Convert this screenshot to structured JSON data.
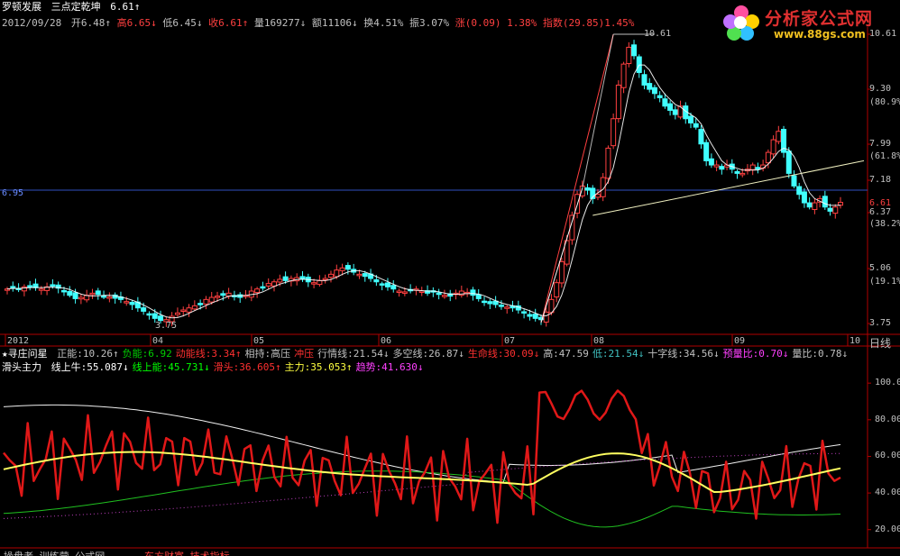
{
  "header": {
    "stock_name": "罗顿发展",
    "indicator_name": "三点定乾坤",
    "indicator_value": "6.61↑",
    "date": "2012/09/28",
    "open_label": "开",
    "open": "6.48↑",
    "high_label": "高",
    "high": "6.65↓",
    "low_label": "低",
    "low": "6.45↓",
    "close_label": "收",
    "close": "6.61↑",
    "vol_label": "量",
    "vol": "169277↓",
    "amt_label": "额",
    "amt": "11106↓",
    "turn_label": "换",
    "turn": "4.51%",
    "amp_label": "振",
    "amp": "3.07%",
    "chg_label": "涨",
    "chg": "(0.09)",
    "chg_pct": "1.38%",
    "idx_label": "指数",
    "idx": "(29.85)",
    "idx_pct": "1.45%"
  },
  "logo": {
    "title": "分析家公式网",
    "url": "www.88gs.com"
  },
  "price_axis": {
    "labels": [
      {
        "value": "10.61",
        "color": "#c0c0c0"
      },
      {
        "value": "9.30",
        "color": "#c0c0c0"
      },
      {
        "value": "(80.9%)",
        "color": "#c0c0c0"
      },
      {
        "value": "7.99",
        "color": "#c0c0c0"
      },
      {
        "value": "(61.8%)",
        "color": "#c0c0c0"
      },
      {
        "value": "7.18",
        "color": "#c0c0c0"
      },
      {
        "value": "6.61",
        "color": "#ff4040"
      },
      {
        "value": "6.37",
        "color": "#c0c0c0"
      },
      {
        "value": "(38.2%)",
        "color": "#c0c0c0"
      },
      {
        "value": "5.06",
        "color": "#c0c0c0"
      },
      {
        "value": "(19.1%)",
        "color": "#c0c0c0"
      },
      {
        "value": "3.75",
        "color": "#c0c0c0"
      }
    ],
    "ref_line_label": "6.95",
    "peak_label": "10.61",
    "trough_label": "3.75"
  },
  "time_axis": {
    "labels": [
      "2012",
      "04",
      "05",
      "06",
      "07",
      "08",
      "09",
      "10"
    ],
    "tab": "日线"
  },
  "indicator1": {
    "prefix": "★寻庄问星",
    "items": [
      {
        "label": "正能:",
        "value": "10.26↑",
        "color": "#c0c0c0"
      },
      {
        "label": "负能:",
        "value": "6.92",
        "color": "#00d000"
      },
      {
        "label": "动能线:",
        "value": "3.34↑",
        "color": "#ff3030"
      },
      {
        "label": "相持:",
        "value": "高压",
        "color": "#c0c0c0"
      },
      {
        "label": "",
        "value": "冲压",
        "color": "#ff3030"
      },
      {
        "label": "行情线:",
        "value": "21.54↓",
        "color": "#c0c0c0"
      },
      {
        "label": "多空线:",
        "value": "26.87↓",
        "color": "#c0c0c0"
      },
      {
        "label": "生命线:",
        "value": "30.09↓",
        "color": "#ff3030"
      },
      {
        "label": "高:",
        "value": "47.59",
        "color": "#c0c0c0"
      },
      {
        "label": "低:",
        "value": "21.54↓",
        "color": "#40c0c0"
      },
      {
        "label": "十字线:",
        "value": "34.56↓",
        "color": "#c0c0c0"
      },
      {
        "label": "预量比:",
        "value": "0.70↓",
        "color": "#ff40ff"
      },
      {
        "label": "量比:",
        "value": "0.78↓",
        "color": "#c0c0c0"
      }
    ]
  },
  "indicator2": {
    "prefix": "滑头主力",
    "items": [
      {
        "label": "线上牛:",
        "value": "55.087↓",
        "color": "#ffffff"
      },
      {
        "label": "线上能:",
        "value": "45.731↓",
        "color": "#00ff00"
      },
      {
        "label": "滑头:",
        "value": "36.605↑",
        "color": "#ff3030"
      },
      {
        "label": "主力:",
        "value": "35.053↑",
        "color": "#ffff40"
      },
      {
        "label": "趋势:",
        "value": "41.630↓",
        "color": "#ff40ff"
      }
    ],
    "axis": [
      "100.00",
      "80.00",
      "60.00",
      "40.00",
      "20.00"
    ]
  },
  "footer": {
    "left_text": "操盘者 训练营 公式网",
    "right_text": "东方财富 技术指标"
  },
  "chart_data": [
    {
      "type": "candlestick",
      "ylim": [
        3.75,
        10.61
      ],
      "peak": 10.61,
      "trough": 3.75,
      "reference_line": 6.95,
      "close_series": [
        4.55,
        4.58,
        4.56,
        4.6,
        4.62,
        4.58,
        4.55,
        4.6,
        4.62,
        4.57,
        4.5,
        4.4,
        4.32,
        4.35,
        4.4,
        4.45,
        4.42,
        4.38,
        4.36,
        4.33,
        4.3,
        4.25,
        4.18,
        4.1,
        4.02,
        3.95,
        3.85,
        3.8,
        3.82,
        3.9,
        3.98,
        4.05,
        4.1,
        4.15,
        4.18,
        4.3,
        4.35,
        4.38,
        4.4,
        4.45,
        4.38,
        4.35,
        4.4,
        4.5,
        4.55,
        4.6,
        4.68,
        4.72,
        4.78,
        4.75,
        4.8,
        4.82,
        4.78,
        4.72,
        4.7,
        4.75,
        4.8,
        4.9,
        5.0,
        5.05,
        5.02,
        4.95,
        4.9,
        4.85,
        4.8,
        4.72,
        4.65,
        4.6,
        4.55,
        4.5,
        4.48,
        4.52,
        4.55,
        4.5,
        4.45,
        4.48,
        4.42,
        4.4,
        4.38,
        4.45,
        4.5,
        4.47,
        4.4,
        4.32,
        4.25,
        4.2,
        4.18,
        4.15,
        4.12,
        4.1,
        4.05,
        3.98,
        3.9,
        3.85,
        3.82,
        4.0,
        4.3,
        4.7,
        5.2,
        5.7,
        6.3,
        6.8,
        7.0,
        6.9,
        6.7,
        6.8,
        7.2,
        7.9,
        8.6,
        9.4,
        9.9,
        10.3,
        10.1,
        9.7,
        9.4,
        9.3,
        9.2,
        9.1,
        8.9,
        8.8,
        8.7,
        8.9,
        8.6,
        8.5,
        8.4,
        8.0,
        7.6,
        7.5,
        7.5,
        7.4,
        7.5,
        7.4,
        7.3,
        7.3,
        7.4,
        7.5,
        7.4,
        7.5,
        7.8,
        8.1,
        8.3,
        7.8,
        7.3,
        7.0,
        6.8,
        6.6,
        6.5,
        6.6,
        6.7,
        6.5,
        6.4,
        6.5,
        6.61
      ]
    },
    {
      "type": "line",
      "ylim": [
        20,
        100
      ],
      "series": [
        {
          "name": "线上牛",
          "color": "#ffffff"
        },
        {
          "name": "线上能",
          "color": "#00ff00"
        },
        {
          "name": "滑头",
          "color": "#ff2020"
        },
        {
          "name": "主力",
          "color": "#ffff40"
        },
        {
          "name": "趋势",
          "color": "#ff40ff"
        }
      ]
    }
  ]
}
